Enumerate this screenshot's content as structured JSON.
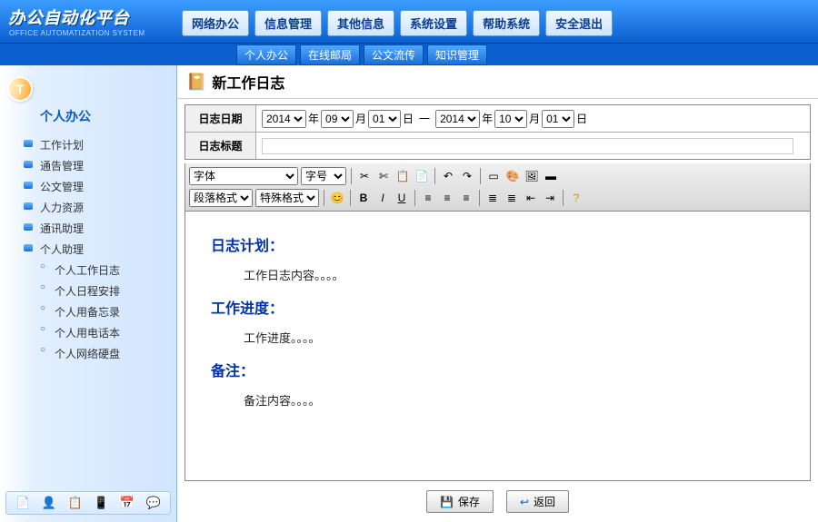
{
  "app": {
    "title": "办公自动化平台",
    "subtitle": "OFFICE AUTOMATIZATION SYSTEM"
  },
  "topnav": [
    "网络办公",
    "信息管理",
    "其他信息",
    "系统设置",
    "帮助系统",
    "安全退出"
  ],
  "subnav": [
    "个人办公",
    "在线邮局",
    "公文流传",
    "知识管理"
  ],
  "sidebar": {
    "title": "个人办公",
    "items": [
      "工作计划",
      "通告管理",
      "公文管理",
      "人力资源",
      "通讯助理",
      "个人助理"
    ],
    "sub": [
      "个人工作日志",
      "个人日程安排",
      "个人用备忘录",
      "个人用电话本",
      "个人网络硬盘"
    ]
  },
  "page": {
    "title": "新工作日志"
  },
  "form": {
    "dateLabel": "日志日期",
    "titleLabel": "日志标题",
    "year1": "2014",
    "month1": "09",
    "day1": "01",
    "year2": "2014",
    "month2": "10",
    "day2": "01",
    "u_year": "年",
    "u_month": "月",
    "u_day": "日",
    "u_sep": "一"
  },
  "editor": {
    "fontSel": "字体",
    "sizeSel": "字号",
    "paraSel": "段落格式",
    "specialSel": "特殊格式",
    "h1": "日志计划：",
    "p1": "工作日志内容。。。。",
    "h2": "工作进度：",
    "p2": "工作进度。。。。",
    "h3": "备注：",
    "p3": "备注内容。。。。"
  },
  "buttons": {
    "save": "保存",
    "back": "返回"
  }
}
